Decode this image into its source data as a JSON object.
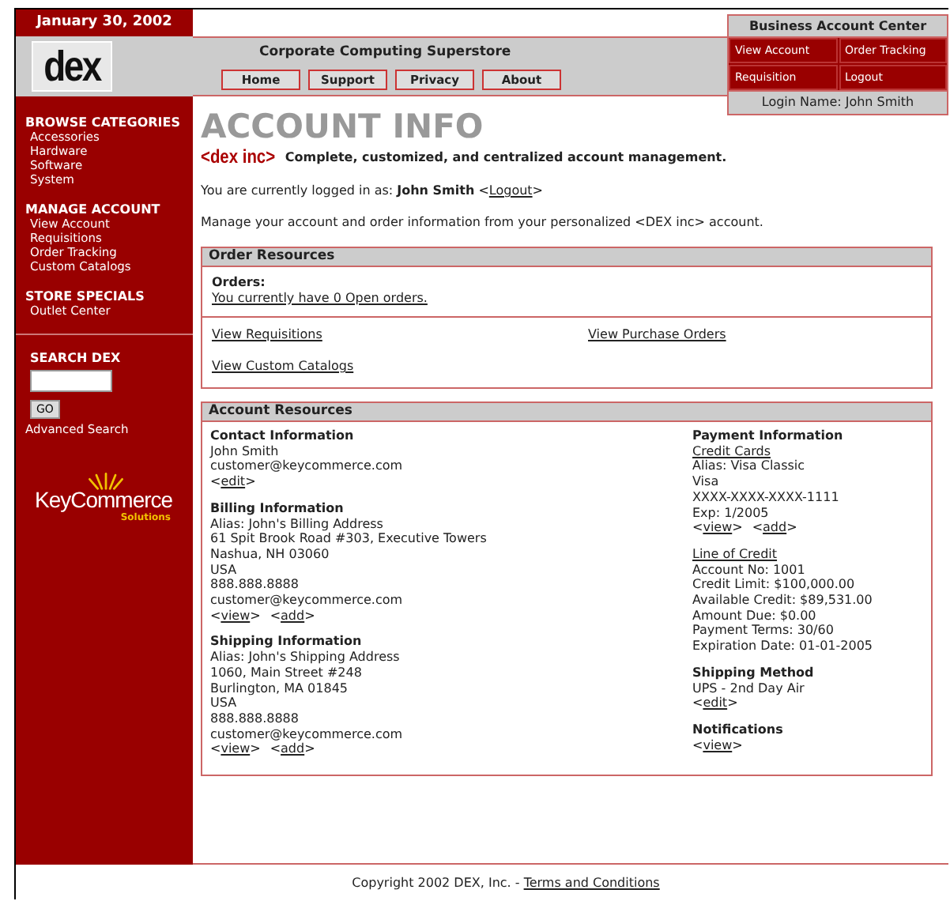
{
  "date": "January 30, 2002",
  "logo": "dex",
  "tagline": "Corporate Computing Superstore",
  "nav": [
    "Home",
    "Support",
    "Privacy",
    "About"
  ],
  "account_center": {
    "title": "Business Account Center",
    "links": [
      "View Account",
      "Order Tracking",
      "Requisition",
      "Logout"
    ],
    "login": "Login Name: John Smith"
  },
  "sidebar": {
    "sections": [
      {
        "title": "BROWSE CATEGORIES",
        "items": [
          "Accessories",
          "Hardware",
          "Software",
          "System"
        ]
      },
      {
        "title": "MANAGE ACCOUNT",
        "items": [
          "View Account",
          "Requisitions",
          "Order Tracking",
          "Custom Catalogs"
        ]
      },
      {
        "title": "STORE SPECIALS",
        "items": [
          "Outlet Center"
        ]
      }
    ],
    "search": {
      "title": "SEARCH DEX",
      "button": "GO",
      "link": "Advanced Search"
    },
    "partner_logo": {
      "name": "KeyCommerce",
      "sub": "Solutions"
    }
  },
  "main": {
    "title": "ACCOUNT INFO",
    "brand": "<dex inc>",
    "brand_text": "Complete, customized, and centralized account management.",
    "login_line": {
      "text": "You are currently logged in as: **John Smith** <",
      "link": "Logout",
      "after": ">"
    },
    "intro": "Manage your account and order information from your personalized <DEX inc> account.",
    "order_resources": {
      "title": "Order Resources",
      "orders_label": "Orders:",
      "orders_link": "You currently have 0 Open orders.",
      "links": [
        "View Requisitions",
        "View Purchase Orders",
        "View Custom Catalogs"
      ]
    },
    "account_resources": {
      "title": "Account Resources",
      "columns": [
        [
          {
            "title": "Contact Information",
            "lines": [
              {
                "kind": "text",
                "text": "John Smith"
              },
              {
                "kind": "text",
                "text": "customer@keycommerce.com"
              },
              {
                "kind": "actions",
                "items": [
                  {
                    "open": "<",
                    "label": "edit",
                    "close": ">"
                  }
                ]
              }
            ]
          },
          {
            "title": "Billing Information",
            "lines": [
              {
                "kind": "text",
                "text": "Alias: John's Billing Address"
              },
              {
                "kind": "text",
                "text": "61 Spit Brook Road #303, Executive Towers"
              },
              {
                "kind": "text",
                "text": "Nashua, NH 03060"
              },
              {
                "kind": "text",
                "text": "USA"
              },
              {
                "kind": "text",
                "text": "888.888.8888"
              },
              {
                "kind": "text",
                "text": "customer@keycommerce.com"
              },
              {
                "kind": "actions",
                "items": [
                  {
                    "open": "<",
                    "label": "view",
                    "close": ">"
                  },
                  {
                    "open": "<",
                    "label": "add",
                    "close": ">"
                  }
                ]
              }
            ]
          },
          {
            "title": "Shipping Information",
            "lines": [
              {
                "kind": "text",
                "text": "Alias: John's Shipping Address"
              },
              {
                "kind": "text",
                "text": "1060, Main Street #248"
              },
              {
                "kind": "text",
                "text": "Burlington, MA 01845"
              },
              {
                "kind": "text",
                "text": "USA"
              },
              {
                "kind": "text",
                "text": "888.888.8888"
              },
              {
                "kind": "text",
                "text": "customer@keycommerce.com"
              },
              {
                "kind": "actions",
                "items": [
                  {
                    "open": "<",
                    "label": "view",
                    "close": ">"
                  },
                  {
                    "open": "<",
                    "label": "add",
                    "close": ">"
                  }
                ]
              }
            ]
          }
        ],
        [
          {
            "title": "Payment Information",
            "lines": [
              {
                "kind": "link",
                "text": "Credit Cards"
              },
              {
                "kind": "text",
                "text": "Alias: Visa Classic"
              },
              {
                "kind": "text",
                "text": "Visa"
              },
              {
                "kind": "text",
                "text": "XXXX-XXXX-XXXX-1111"
              },
              {
                "kind": "text",
                "text": "Exp: 1/2005"
              },
              {
                "kind": "actions",
                "items": [
                  {
                    "open": "<",
                    "label": "view",
                    "close": ">"
                  },
                  {
                    "open": "<",
                    "label": "add",
                    "close": ">"
                  }
                ]
              }
            ]
          },
          {
            "lines": [
              {
                "kind": "link",
                "text": "Line of Credit"
              },
              {
                "kind": "text",
                "text": "Account No: 1001"
              },
              {
                "kind": "text",
                "text": "Credit Limit: $100,000.00"
              },
              {
                "kind": "text",
                "text": "Available Credit: $89,531.00"
              },
              {
                "kind": "text",
                "text": "Amount Due: $0.00"
              },
              {
                "kind": "text",
                "text": "Payment Terms: 30/60"
              },
              {
                "kind": "text",
                "text": "Expiration Date: 01-01-2005"
              }
            ]
          },
          {
            "title": "Shipping Method",
            "lines": [
              {
                "kind": "text",
                "text": "UPS - 2nd Day Air"
              },
              {
                "kind": "actions",
                "items": [
                  {
                    "open": "<",
                    "label": "edit",
                    "close": ">"
                  }
                ]
              }
            ]
          },
          {
            "title": "Notifications",
            "lines": [
              {
                "kind": "actions",
                "items": [
                  {
                    "open": "<",
                    "label": "view",
                    "close": ">"
                  }
                ]
              }
            ]
          }
        ]
      ]
    }
  },
  "footer": {
    "text": "Copyright 2002 DEX, Inc. - ",
    "link": "Terms and Conditions"
  }
}
